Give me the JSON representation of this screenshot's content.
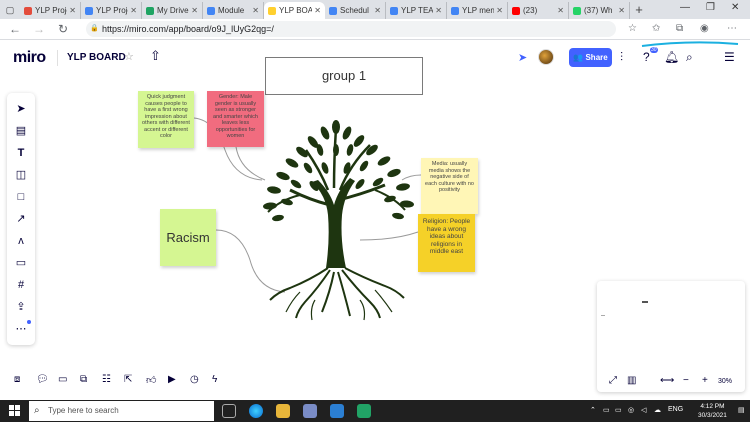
{
  "browser": {
    "tabs": [
      {
        "title": "YLP Proje",
        "color": "#e34c3c"
      },
      {
        "title": "YLP Proje",
        "color": "#4285f4"
      },
      {
        "title": "My Drive",
        "color": "#1fa463"
      },
      {
        "title": "Module",
        "color": "#4285f4"
      },
      {
        "title": "YLP BOA",
        "color": "#ffd02f"
      },
      {
        "title": "Schedul",
        "color": "#4285f4"
      },
      {
        "title": "YLP TEA",
        "color": "#4285f4"
      },
      {
        "title": "YLP men",
        "color": "#4285f4"
      },
      {
        "title": "(23)",
        "color": "#ff0000"
      },
      {
        "title": "(37) Wh",
        "color": "#25d366"
      }
    ],
    "url": "https://miro.com/app/board/o9J_lUyG2qg=/"
  },
  "miro": {
    "logo": "miro",
    "board_name": "YLP BOARD",
    "share_label": "Share",
    "notification_count": "30"
  },
  "board": {
    "frame_title": "group 1",
    "stickies": {
      "judgment": "Quick judgment causes people to have a first wrong impression about others with different accent or different color",
      "gender": "Gender: Male gender is usually seen as stronger and smarter which leaves less opportunities for women",
      "media": "Media: usually media shows the negative side of each culture with no positivity",
      "religion": "Religion: People have a wrong ideas about religions in middle east",
      "racism": "Racism"
    }
  },
  "minimap": {
    "zoom": "30%"
  },
  "taskbar": {
    "search_placeholder": "Type here to search",
    "language": "ENG",
    "time": "4:12 PM",
    "date": "30/3/2021"
  },
  "colors": {
    "accent": "#4262ff",
    "tree": "#1e3510",
    "sticky_green": "#d5f692",
    "sticky_red": "#f16c7f",
    "sticky_yellow_light": "#fff6b6",
    "sticky_yellow": "#f5d128"
  }
}
